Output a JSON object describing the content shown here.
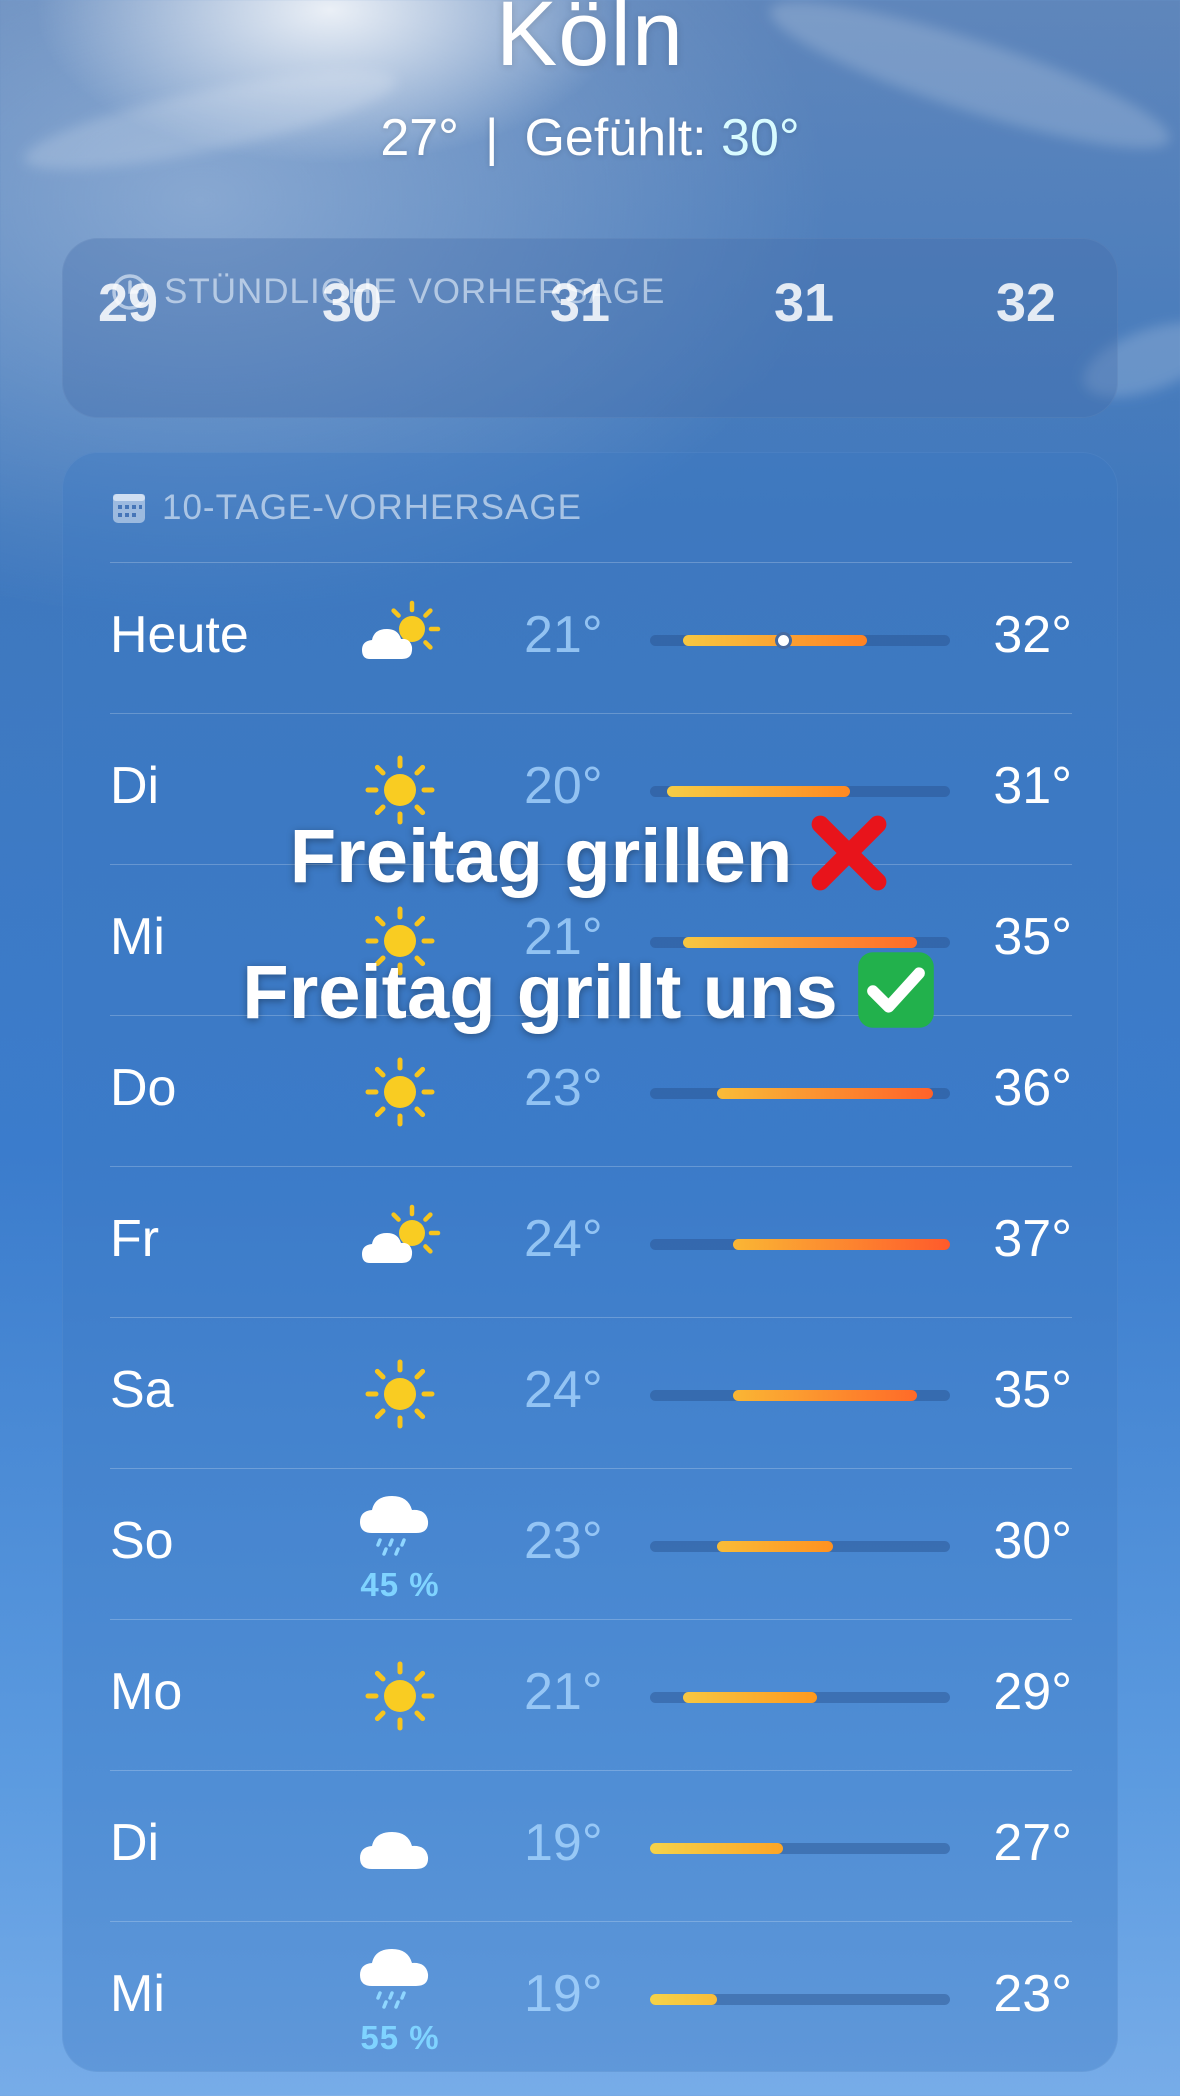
{
  "header": {
    "city": "Köln",
    "temp": "27°",
    "separator": "|",
    "feels_label": "Gefühlt:",
    "feels_value": "30°"
  },
  "hourly": {
    "title": "STÜNDLICHE VORHERSAGE",
    "values": [
      "29",
      "30",
      "31",
      "31",
      "32"
    ]
  },
  "daily": {
    "title": "10-TAGE-VORHERSAGE",
    "rows": [
      {
        "day": "Heute",
        "icon": "partly-sunny-icon",
        "low": "21°",
        "high": "32°",
        "precip": ""
      },
      {
        "day": "Di",
        "icon": "sun-icon",
        "low": "20°",
        "high": "31°",
        "precip": ""
      },
      {
        "day": "Mi",
        "icon": "sun-icon",
        "low": "21°",
        "high": "35°",
        "precip": ""
      },
      {
        "day": "Do",
        "icon": "sun-icon",
        "low": "23°",
        "high": "36°",
        "precip": ""
      },
      {
        "day": "Fr",
        "icon": "partly-sunny-icon",
        "low": "24°",
        "high": "37°",
        "precip": ""
      },
      {
        "day": "Sa",
        "icon": "sun-icon",
        "low": "24°",
        "high": "35°",
        "precip": ""
      },
      {
        "day": "So",
        "icon": "rain-icon",
        "low": "23°",
        "high": "30°",
        "precip": "45 %"
      },
      {
        "day": "Mo",
        "icon": "sun-icon",
        "low": "21°",
        "high": "29°",
        "precip": ""
      },
      {
        "day": "Di",
        "icon": "cloud-icon",
        "low": "19°",
        "high": "27°",
        "precip": ""
      },
      {
        "day": "Mi",
        "icon": "rain-icon",
        "low": "19°",
        "high": "23°",
        "precip": "55 %"
      }
    ],
    "range_min": 19,
    "range_max": 37,
    "current_temp": 27
  },
  "overlay": {
    "line1": "Freitag grillen",
    "line2": "Freitag grillt uns"
  },
  "colors": {
    "cool": "#f5d34a",
    "warm": "#ff9a1e",
    "hot": "#ff5a2b"
  }
}
